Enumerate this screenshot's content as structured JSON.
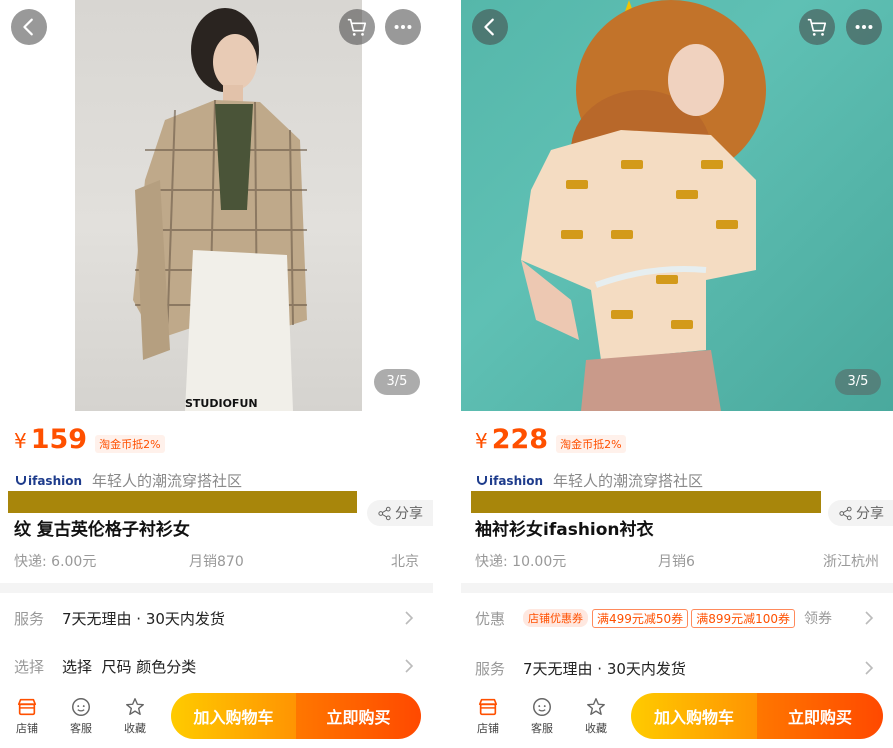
{
  "left": {
    "image_counter": "3/5",
    "watermark": "STUDIOFUN",
    "currency": "¥",
    "price": "159",
    "coin_tag": "淘金币抵2%",
    "brand": "ifashion",
    "slogan": "年轻人的潮流穿搭社区",
    "share": "分享",
    "title": "纹 复古英伦格子衬衫女",
    "shipping": "快递: 6.00元",
    "sales": "月销870",
    "location": "北京",
    "service_label": "服务",
    "service_value": "7天无理由 · 30天内发货",
    "select_label": "选择",
    "select_value": "选择  尺码 颜色分类"
  },
  "right": {
    "image_counter": "3/5",
    "currency": "¥",
    "price": "228",
    "coin_tag": "淘金币抵2%",
    "brand": "ifashion",
    "slogan": "年轻人的潮流穿搭社区",
    "share": "分享",
    "title": "袖衬衫女ifashion衬衣",
    "shipping": "快递: 10.00元",
    "sales": "月销6",
    "location": "浙江杭州",
    "promo_label": "优惠",
    "promo_tag": "店铺优惠券",
    "coupon1": "满499元减50券",
    "coupon2": "满899元减100券",
    "claim": "领券",
    "service_label": "服务",
    "service_value": "7天无理由 · 30天内发货"
  },
  "bottom_bar": {
    "store": "店铺",
    "service": "客服",
    "favorite": "收藏",
    "add_to_cart": "加入购物车",
    "buy_now": "立即购买"
  },
  "colors": {
    "price": "#ff5000",
    "cart_gradient": [
      "#ffcb00",
      "#ff9402"
    ],
    "buy_gradient": [
      "#ff7700",
      "#ff4900"
    ],
    "redaction": "#a8860b"
  },
  "icons": [
    "back-icon",
    "cart-icon",
    "more-icon",
    "share-icon",
    "store-icon",
    "chat-icon",
    "star-icon",
    "chevron-right-icon"
  ]
}
